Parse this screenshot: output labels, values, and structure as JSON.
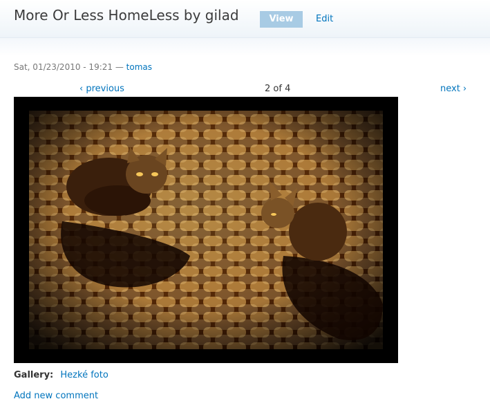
{
  "header": {
    "title": "More Or Less HomeLess by gilad",
    "tabs": [
      {
        "label": "View",
        "active": true
      },
      {
        "label": "Edit",
        "active": false
      }
    ]
  },
  "submitted": {
    "date": "Sat, 01/23/2010 - 19:21",
    "separator": "—",
    "author": "tomas"
  },
  "pager": {
    "previous": "‹ previous",
    "count": "2 of 4",
    "next": "next ›"
  },
  "gallery": {
    "label": "Gallery:",
    "name": "Hezké foto"
  },
  "links": {
    "add_comment": "Add new comment"
  },
  "colors": {
    "link": "#0074bd",
    "active_tab": "#a8cbe4"
  }
}
